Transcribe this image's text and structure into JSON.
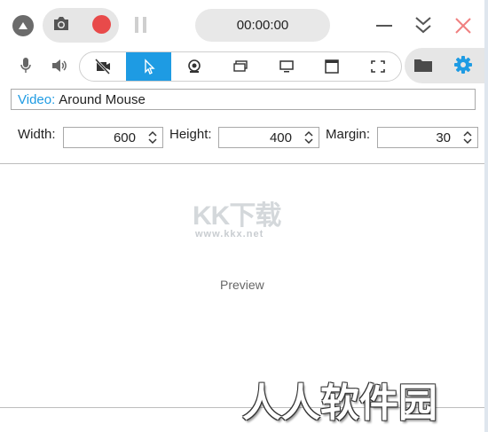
{
  "toolbar": {
    "timer": "00:00:00",
    "colors": {
      "record": "#e84a4a",
      "accent": "#1e9be3",
      "close": "#f08080"
    }
  },
  "source_modes": [
    {
      "icon": "no-camera-icon",
      "active": false
    },
    {
      "icon": "cursor-icon",
      "active": true
    },
    {
      "icon": "webcam-icon",
      "active": false
    },
    {
      "icon": "screens-icon",
      "active": false
    },
    {
      "icon": "monitor-icon",
      "active": false
    },
    {
      "icon": "window-icon",
      "active": false
    },
    {
      "icon": "region-icon",
      "active": false
    }
  ],
  "video": {
    "label": "Video:",
    "value": "Around Mouse"
  },
  "dimensions": {
    "width_label": "Width:",
    "width_value": "600",
    "height_label": "Height:",
    "height_value": "400",
    "margin_label": "Margin:",
    "margin_value": "30"
  },
  "preview": {
    "label": "Preview"
  },
  "watermarks": {
    "logo": "KK下载",
    "url": "www.kkx.net",
    "corner": "人人软件园"
  }
}
